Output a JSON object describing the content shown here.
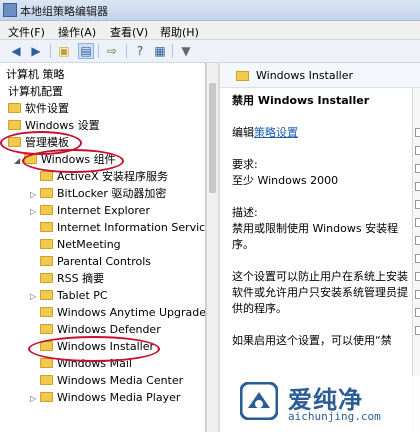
{
  "window": {
    "title": "本地组策略编辑器"
  },
  "menu": [
    {
      "label": "文件(F)"
    },
    {
      "label": "操作(A)"
    },
    {
      "label": "查看(V)"
    },
    {
      "label": "帮助(H)"
    }
  ],
  "toolbar": [
    {
      "icon": "back-arrow-icon"
    },
    {
      "icon": "forward-arrow-icon"
    },
    {
      "icon": "up-folder-icon"
    },
    {
      "icon": "show-hide-tree-icon"
    },
    {
      "icon": "export-list-icon"
    },
    {
      "icon": "help-icon"
    },
    {
      "icon": "properties-icon"
    },
    {
      "icon": "filter-icon"
    }
  ],
  "tree": {
    "items": [
      {
        "label": "计算机 策略",
        "indent": 0,
        "folder": false,
        "arrow": ""
      },
      {
        "label": "计算机配置",
        "indent": 0,
        "folder": false,
        "arrow": ""
      },
      {
        "label": "软件设置",
        "indent": 0,
        "folder": true,
        "arrow": ""
      },
      {
        "label": "Windows 设置",
        "indent": 0,
        "folder": true,
        "arrow": ""
      },
      {
        "label": "管理模板",
        "indent": 0,
        "folder": true,
        "arrow": ""
      },
      {
        "label": "Windows 组件",
        "indent": 1,
        "folder": true,
        "arrow": "◢"
      },
      {
        "label": "ActiveX 安装程序服务",
        "indent": 2,
        "folder": true,
        "arrow": ""
      },
      {
        "label": "BitLocker 驱动器加密",
        "indent": 2,
        "folder": true,
        "arrow": "▷"
      },
      {
        "label": "Internet Explorer",
        "indent": 2,
        "folder": true,
        "arrow": "▷"
      },
      {
        "label": "Internet Information Services",
        "indent": 2,
        "folder": true,
        "arrow": ""
      },
      {
        "label": "NetMeeting",
        "indent": 2,
        "folder": true,
        "arrow": ""
      },
      {
        "label": "Parental Controls",
        "indent": 2,
        "folder": true,
        "arrow": ""
      },
      {
        "label": "RSS 摘要",
        "indent": 2,
        "folder": true,
        "arrow": ""
      },
      {
        "label": "Tablet PC",
        "indent": 2,
        "folder": true,
        "arrow": "▷"
      },
      {
        "label": "Windows Anytime Upgrade",
        "indent": 2,
        "folder": true,
        "arrow": ""
      },
      {
        "label": "Windows Defender",
        "indent": 2,
        "folder": true,
        "arrow": ""
      },
      {
        "label": "Windows Installer",
        "indent": 2,
        "folder": true,
        "arrow": ""
      },
      {
        "label": "Windows Mail",
        "indent": 2,
        "folder": true,
        "arrow": ""
      },
      {
        "label": "Windows Media Center",
        "indent": 2,
        "folder": true,
        "arrow": ""
      },
      {
        "label": "Windows Media Player",
        "indent": 2,
        "folder": true,
        "arrow": "▷"
      }
    ]
  },
  "detail": {
    "header_title": "Windows Installer",
    "heading": "禁用 Windows Installer",
    "edit_prefix": "编辑",
    "edit_link": "策略设置",
    "req_label": "要求:",
    "req_value": "至少 Windows 2000",
    "desc_label": "描述:",
    "desc_text": "禁用或限制使用 Windows 安装程序。",
    "para1": "这个设置可以防止用户在系统上安装软件或允许用户只安装系统管理员提供的程序。",
    "para2": "如果启用这个设置，可以使用“禁"
  },
  "watermark": {
    "brand": "爱纯净",
    "url": "aichunjing.com"
  },
  "colors": {
    "annotation": "#c8102e",
    "link": "#1a5fb4",
    "folder": "#f2c94c"
  }
}
